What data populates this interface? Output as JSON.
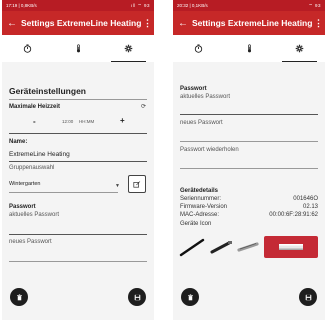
{
  "left": {
    "status_time": "17:19 | 0,8KB/s",
    "status_icons": "ıll ⌔ 93",
    "title": "Settings ExtremeLine Heating",
    "section_title": "Geräteinstellungen",
    "max_heat_label": "Maximale Heizzeit",
    "minus": "-",
    "time_value": "12:00",
    "time_unit": "HH:MM",
    "plus": "+",
    "name_label": "Name:",
    "name_value": "ExtremeLine Heating",
    "group_label": "Gruppenauswahl",
    "group_value": "Wintergarten",
    "password_label": "Passwort",
    "current_password_placeholder": "aktuelles Passwort",
    "new_password_placeholder": "neues Passwort"
  },
  "right": {
    "status_time": "20:32 | 0,1KB/s",
    "status_icons": "⌔ 93",
    "title": "Settings ExtremeLine Heating",
    "password_label": "Passwort",
    "current_password_placeholder": "aktuelles Passwort",
    "new_password_placeholder": "neues Passwort",
    "repeat_password_placeholder": "Passwort wiederholen",
    "details_label": "Gerätedetails",
    "serial_key": "Seriennummer:",
    "serial_value": "001646O",
    "firmware_key": "Firmware-Version",
    "firmware_value": "02.13",
    "mac_key": "MAC-Adresse:",
    "mac_value": "00:00:6F:28:91:62",
    "device_icon_label": "Geräte Icon"
  },
  "colors": {
    "appbar": "#c62828",
    "statusbar": "#b71c24",
    "fab": "#1e1e1e",
    "selected_icon": "#c42a35"
  },
  "icons": {
    "back": "arrow-left-icon",
    "menu": "more-vert-icon",
    "tab1": "timer-icon",
    "tab2": "thermometer-icon",
    "tab3": "gear-icon",
    "delete": "trash-icon",
    "save": "floppy-disk-icon",
    "edit": "edit-icon",
    "sync": "sync-icon"
  }
}
